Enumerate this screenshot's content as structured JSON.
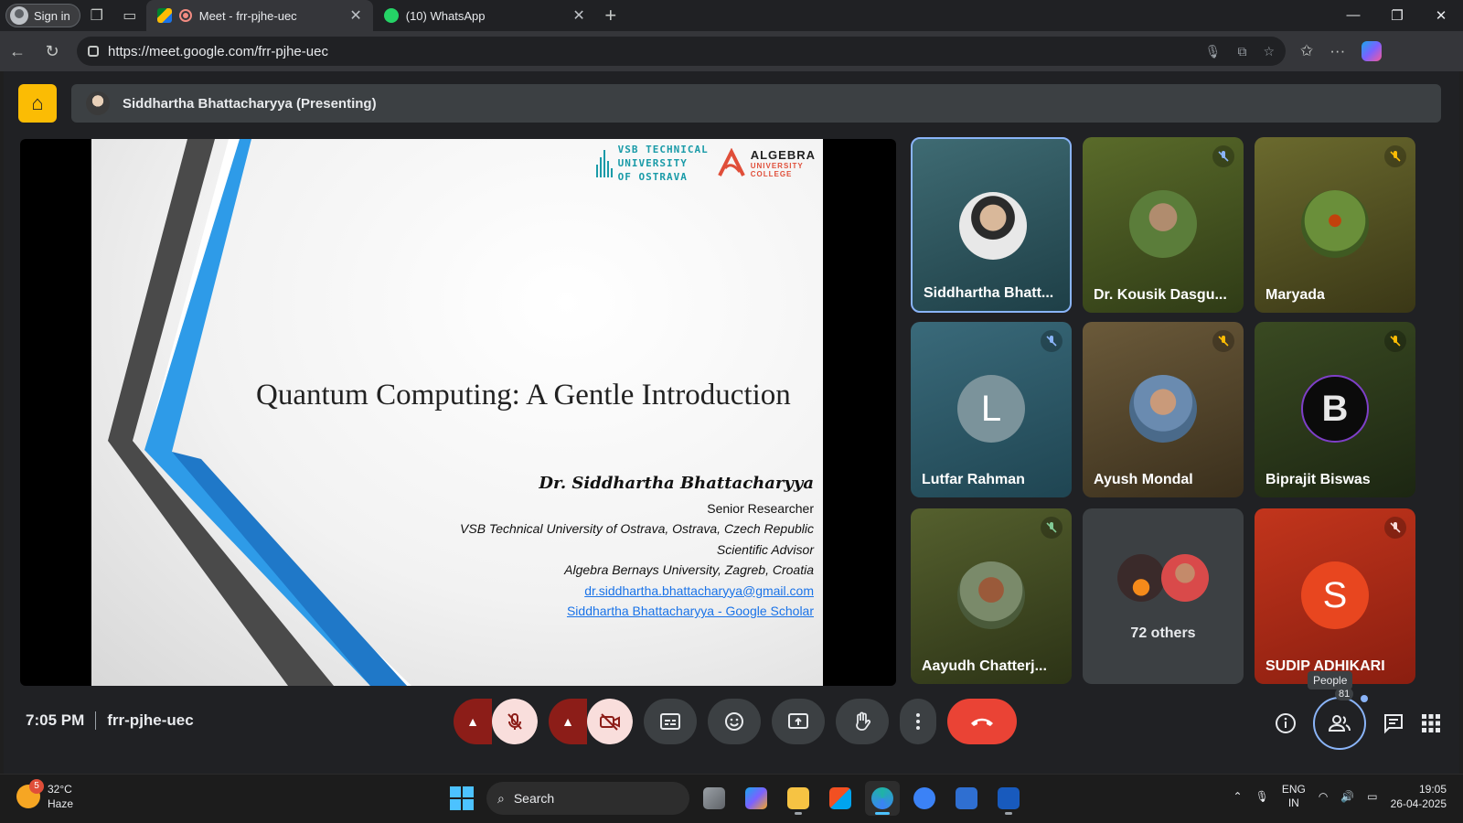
{
  "browser": {
    "signin_label": "Sign in",
    "tabs": [
      {
        "title": "Meet - frr-pjhe-uec"
      },
      {
        "title": "(10) WhatsApp"
      }
    ],
    "url": "https://meet.google.com/frr-pjhe-uec"
  },
  "meet": {
    "presenter_label": "Siddhartha Bhattacharyya (Presenting)",
    "slide": {
      "logo_vsb": [
        "VSB TECHNICAL",
        "UNIVERSITY",
        "OF OSTRAVA"
      ],
      "logo_algebra_name": "ALGEBRA",
      "logo_algebra_sub": [
        "UNIVERSITY",
        "COLLEGE"
      ],
      "title": "Quantum Computing: A Gentle Introduction",
      "author": "Dr. Siddhartha Bhattacharyya",
      "role1": "Senior Researcher",
      "affil1": "VSB Technical University of Ostrava, Ostrava, Czech Republic",
      "role2": "Scientific Advisor",
      "affil2": "Algebra Bernays University, Zagreb, Croatia",
      "email": "dr.siddhartha.bhattacharyya@gmail.com",
      "scholar": "Siddhartha Bhattacharyya - Google Scholar"
    },
    "participants": [
      {
        "name": "Siddhartha Bhatt...",
        "muted": false
      },
      {
        "name": "Dr. Kousik Dasgu...",
        "muted": true
      },
      {
        "name": "Maryada",
        "muted": true
      },
      {
        "name": "Lutfar Rahman",
        "initial": "L",
        "muted": true
      },
      {
        "name": "Ayush Mondal",
        "muted": true
      },
      {
        "name": "Biprajit Biswas",
        "initial": "B",
        "muted": true
      },
      {
        "name": "Aayudh Chatterj...",
        "muted": true
      },
      {
        "name": "72 others"
      },
      {
        "name": "SUDIP ADHIKARI",
        "initial": "S",
        "muted": true
      }
    ],
    "time": "7:05 PM",
    "meeting_code": "frr-pjhe-uec",
    "people_tooltip": "People",
    "people_count": "81"
  },
  "taskbar": {
    "weather_temp": "32°C",
    "weather_desc": "Haze",
    "weather_badge": "5",
    "search_label": "Search",
    "lang1": "ENG",
    "lang2": "IN",
    "clock_time": "19:05",
    "clock_date": "26-04-2025"
  },
  "colors": {
    "meet_bg": "#202124",
    "accent_blue": "#8ab4f8",
    "hangup_red": "#ea4335",
    "door_yellow": "#fbbc04"
  }
}
